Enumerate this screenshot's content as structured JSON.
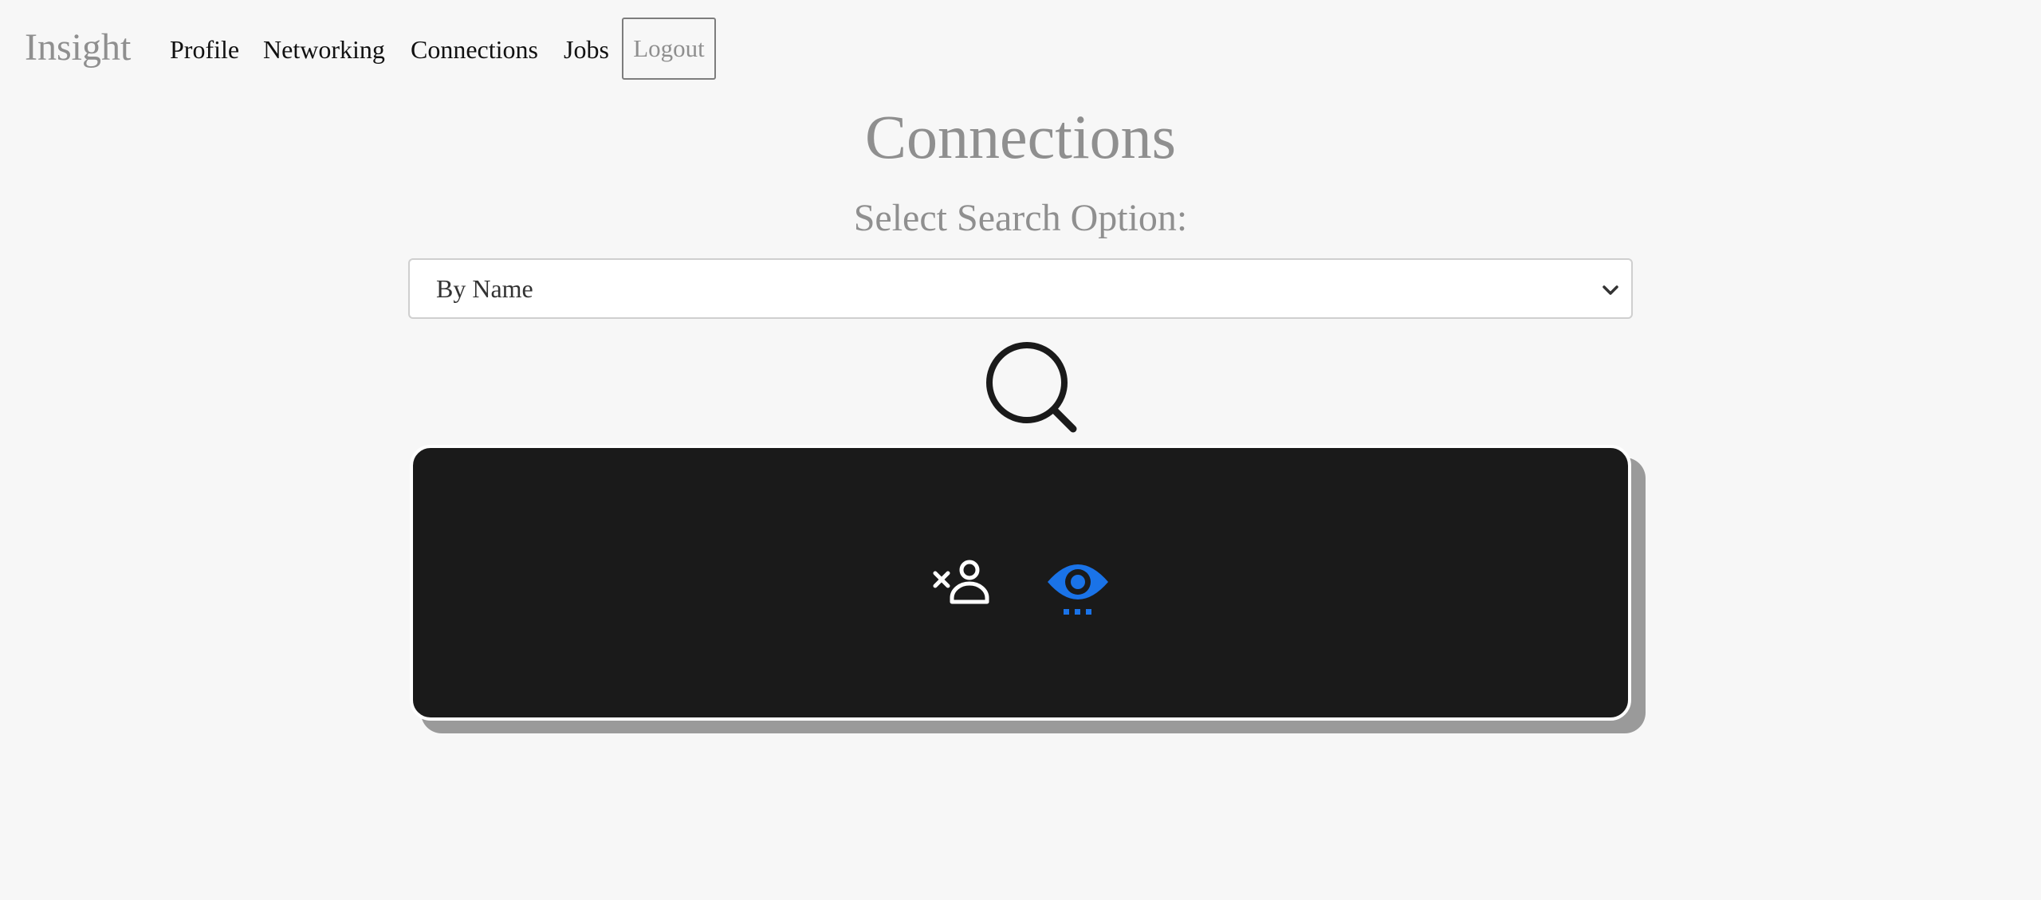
{
  "nav": {
    "brand": "Insight",
    "links": [
      "Profile",
      "Networking",
      "Connections",
      "Jobs"
    ],
    "logout": "Logout"
  },
  "main": {
    "title": "Connections",
    "subtitle": "Select Search Option:",
    "search_option": {
      "selected": "By Name"
    }
  },
  "icons": {
    "search": "search-icon",
    "remove_connection": "person-remove-icon",
    "view_profile": "eye-icon"
  },
  "colors": {
    "background": "#f7f7f7",
    "card": "#1a1a1a",
    "accent": "#1a73e8",
    "muted_text": "#8f8f8f"
  }
}
